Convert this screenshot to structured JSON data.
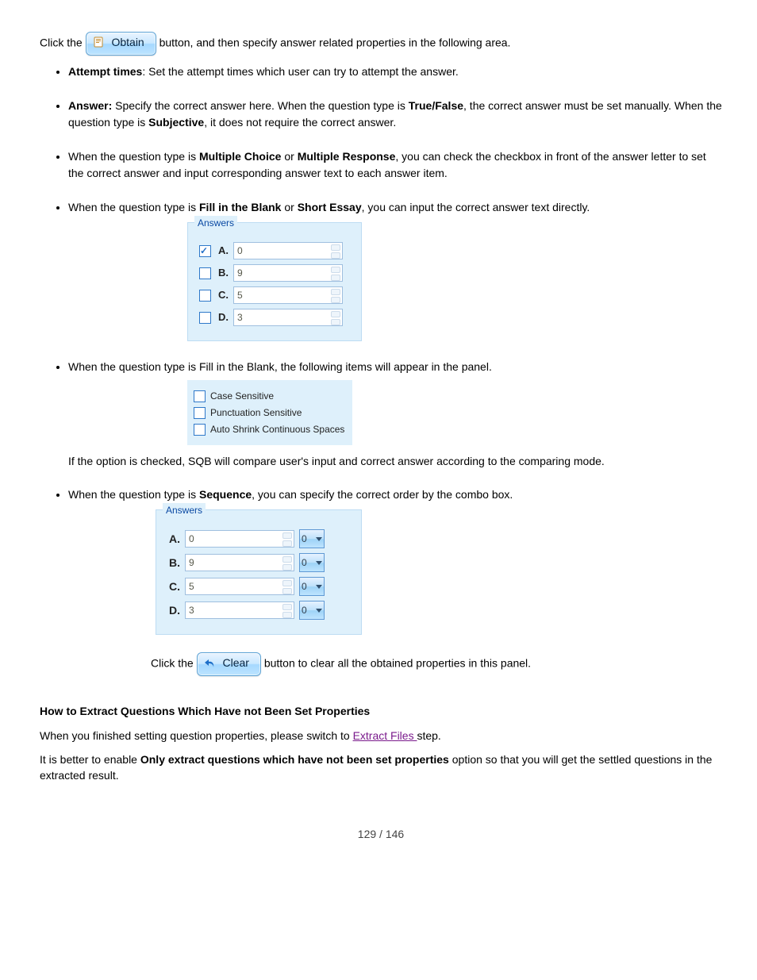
{
  "para_obtain": {
    "prefix": "Click the",
    "button": "Obtain",
    "after": "button, and then specify answer related properties in",
    "after2": "the following area."
  },
  "bullets": [
    {
      "strong": "Attempt times",
      "text": ": Set the attempt times which user can try to attempt the answer."
    },
    {
      "strong": "Answer: ",
      "text": "Specify the correct answer here. When the question type is ",
      "strong2": "True/False",
      "text2": ", the correct answer must be set manually. When the question type is ",
      "strong3": "Subjective",
      "text3": ", it does not require the correct answer."
    },
    {
      "text": "When the question type is ",
      "strong": "Multiple Choice",
      "text2": " or ",
      "strong2": "Multiple Response",
      "text3": ", you can check the checkbox in front of the answer letter to set the correct answer and input corresponding answer text to each answer item."
    },
    {
      "text": "When the question type is ",
      "strong": "Fill in the Blank ",
      "text2": "or",
      "strong2": " Short Essay",
      "text3": ", you can input the correct answer text directly."
    }
  ],
  "answers1": {
    "legend": "Answers",
    "rows": [
      {
        "letter": "A.",
        "val": "0",
        "checked": true
      },
      {
        "letter": "B.",
        "val": "9",
        "checked": false
      },
      {
        "letter": "C.",
        "val": "5",
        "checked": false
      },
      {
        "letter": "D.",
        "val": "3",
        "checked": false
      }
    ]
  },
  "bullet_fib": "When the question type is Fill in the Blank, the following items will appear in the panel.",
  "fib_opts": [
    {
      "label": "Case Sensitive"
    },
    {
      "label": "Punctuation Sensitive"
    },
    {
      "label": "Auto Shrink Continuous Spaces"
    }
  ],
  "fib_note": "If the option is checked, SQB will compare user's input and correct answer according to the comparing mode.",
  "bullet_seq_intro": {
    "text": "When the question type is ",
    "strong": "Sequence",
    "text2": ", you can specify the correct order by the combo box."
  },
  "answers2": {
    "legend": "Answers",
    "rows": [
      {
        "letter": "A.",
        "val": "0",
        "sel": "0"
      },
      {
        "letter": "B.",
        "val": "9",
        "sel": "0"
      },
      {
        "letter": "C.",
        "val": "5",
        "sel": "0"
      },
      {
        "letter": "D.",
        "val": "3",
        "sel": "0"
      }
    ]
  },
  "clear": {
    "prefix": "Click the ",
    "button": "Clear",
    "suffix": "button to clear all the obtained properties in this panel."
  },
  "extract": {
    "heading": "How to Extract Questions Which Have not Been Set Properties",
    "p1_a": "When you finished setting question properties, please switch to ",
    "link": "Extract Files ",
    "p1_b": "step.",
    "p2_a": "It is better to enable ",
    "bold": "Only extract questions which have not been set properties",
    "p2_b": " option so that you will get the settled questions in the extracted result."
  },
  "pageno": "129 / 146"
}
